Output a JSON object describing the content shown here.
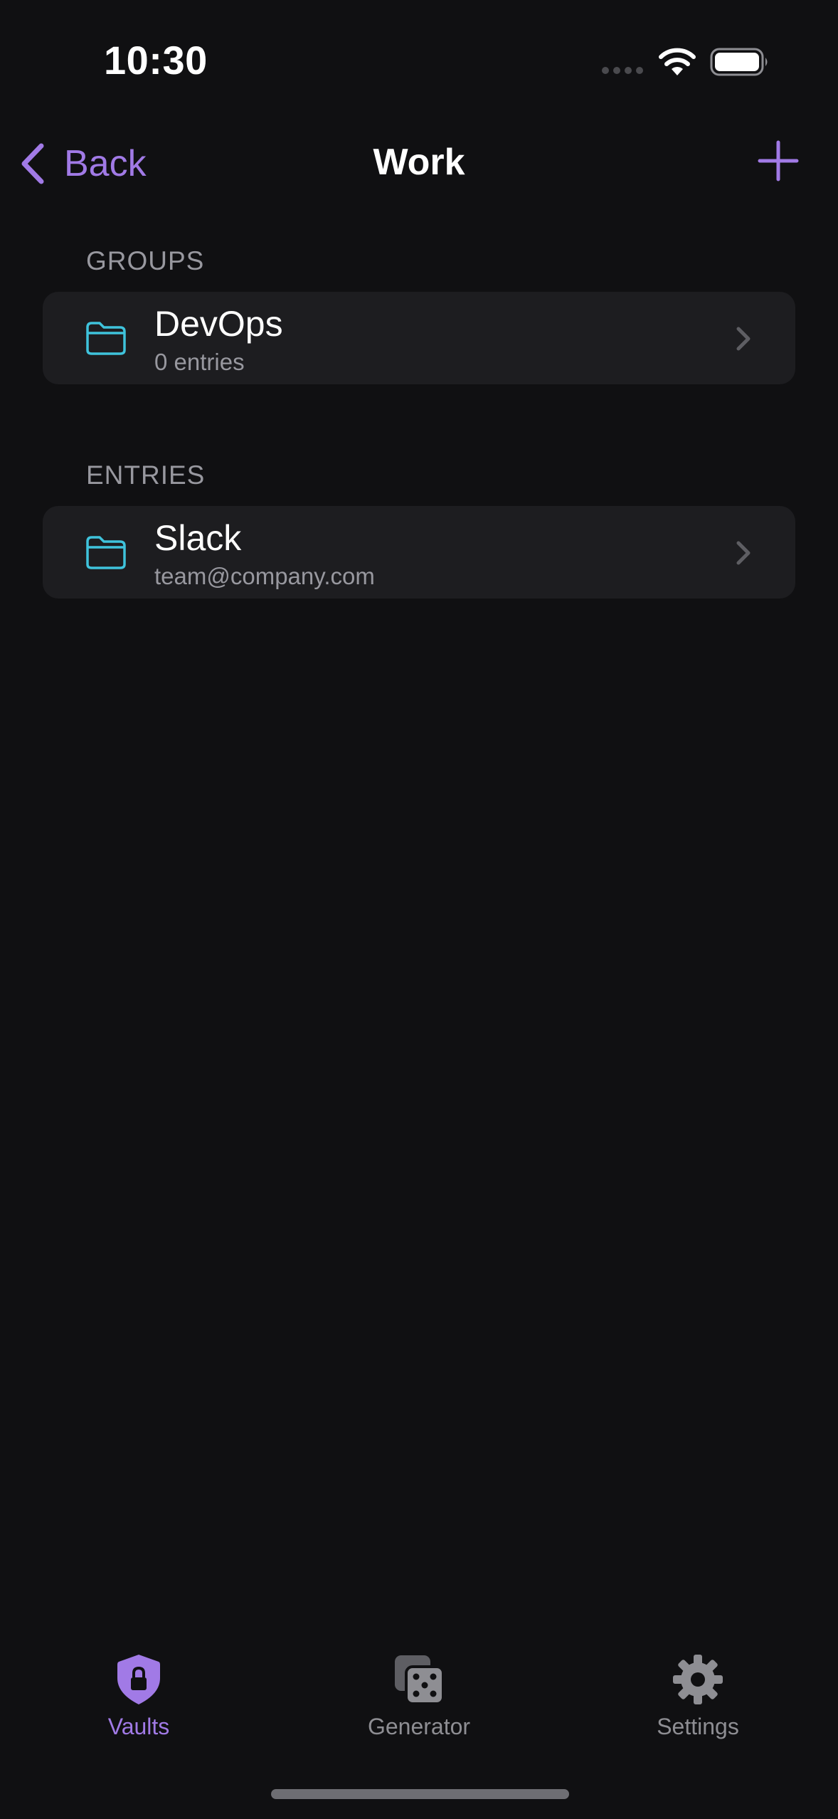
{
  "status_bar": {
    "time": "10:30"
  },
  "nav": {
    "back_label": "Back",
    "title": "Work",
    "add_icon": "plus-icon"
  },
  "groups": {
    "header": "GROUPS",
    "items": [
      {
        "title": "DevOps",
        "subtitle": "0 entries",
        "icon": "folder-icon"
      }
    ]
  },
  "entries": {
    "header": "ENTRIES",
    "items": [
      {
        "title": "Slack",
        "subtitle": "team@company.com",
        "icon": "folder-icon"
      }
    ]
  },
  "tab_bar": {
    "tabs": [
      {
        "label": "Vaults",
        "icon": "shield-lock-icon",
        "active": true
      },
      {
        "label": "Generator",
        "icon": "dice-icon",
        "active": false
      },
      {
        "label": "Settings",
        "icon": "gear-icon",
        "active": false
      }
    ]
  },
  "colors": {
    "background": "#101012",
    "card": "#1d1d20",
    "accent": "#a17ae6",
    "folder": "#3fc3dc",
    "secondary_text": "#98989f"
  }
}
